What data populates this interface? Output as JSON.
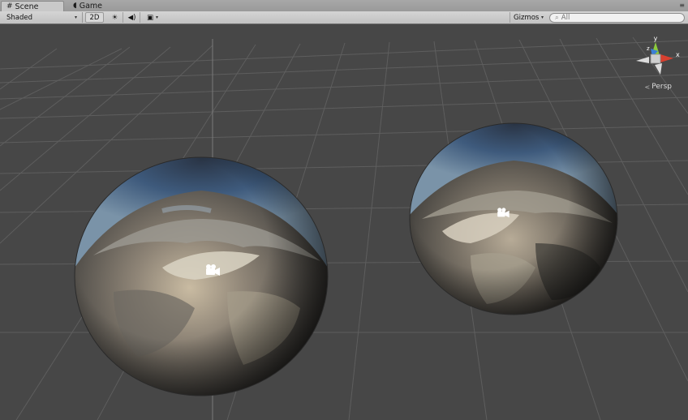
{
  "tabs": [
    {
      "label": "Scene",
      "icon": "grid-icon",
      "glyph": "#"
    },
    {
      "label": "Game",
      "icon": "pacman-icon",
      "glyph": "◖"
    }
  ],
  "panel_menu_glyph": "≡",
  "toolbar": {
    "shading_mode": "Shaded",
    "toggle_2d": "2D",
    "lighting_glyph": "☀",
    "audio_glyph": "◀)",
    "effects_glyph": "▣",
    "dropdown_caret": "▾",
    "gizmos_label": "Gizmos",
    "search_placeholder": "All",
    "search_glyph": "⌕"
  },
  "scene_gizmo": {
    "projection_label": "Persp",
    "axis_labels": [
      "y",
      "x",
      "z"
    ],
    "axis_colors": {
      "x": "#d8402f",
      "y": "#8ccb3c",
      "z": "#3b7fd6"
    }
  },
  "colors": {
    "viewport_bg": "#474747",
    "grid_line": "#5c5c5c",
    "toolbar_bg": "#c8c8c8"
  }
}
